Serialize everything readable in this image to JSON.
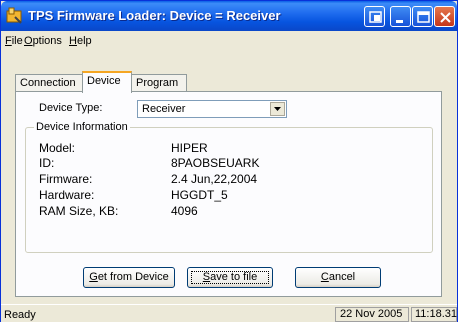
{
  "window": {
    "title": "TPS Firmware Loader:  Device = Receiver"
  },
  "menu": {
    "file_hot": "F",
    "file_rest": "ile",
    "options_hot": "O",
    "options_rest": "ptions",
    "help_hot": "H",
    "help_rest": "elp"
  },
  "tabs": {
    "connection": "Connection",
    "device": "Device",
    "program": "Program"
  },
  "device_type": {
    "label": "Device Type:",
    "value": "Receiver"
  },
  "device_info": {
    "legend": "Device Information",
    "rows": [
      {
        "label": "Model:",
        "value": "HIPER"
      },
      {
        "label": "ID:",
        "value": "8PAOBSEUARK"
      },
      {
        "label": "Firmware:",
        "value": "2.4 Jun,22,2004"
      },
      {
        "label": "Hardware:",
        "value": "HGGDT_5"
      },
      {
        "label": "RAM Size, KB:",
        "value": "4096"
      }
    ]
  },
  "buttons": {
    "get_hot": "G",
    "get_rest": "et from Device",
    "save_hot": "S",
    "save_rest": "ave to file",
    "cancel_hot": "C",
    "cancel_rest": "ancel"
  },
  "status": {
    "text": "Ready",
    "date": "22 Nov 2005",
    "time": "11:18.31"
  },
  "colors": {
    "titlebar": "#0754DF",
    "window_bg": "#ECE9D8",
    "close_button": "#C5361A"
  },
  "icons": {
    "app": "wrench-icon",
    "extra": "restore-icon",
    "minimize": "minimize-icon",
    "maximize": "maximize-icon",
    "close": "close-icon",
    "dropdown": "chevron-down-icon"
  }
}
